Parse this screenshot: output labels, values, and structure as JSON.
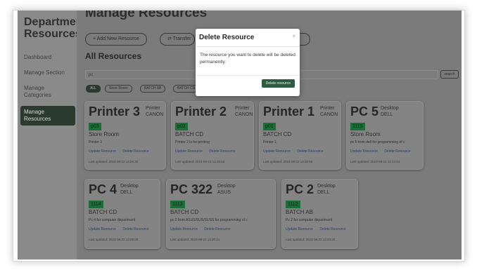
{
  "sidebar": {
    "brand_line1": "Department",
    "brand_line2": "Resources",
    "items": [
      {
        "label": "Dashboard"
      },
      {
        "label": "Manage Section"
      },
      {
        "label": "Manage Categories"
      },
      {
        "label": "Manage Resources"
      }
    ]
  },
  "header": {
    "title": "Manage Resources",
    "add_button": "+  Add New Resource",
    "transfer_button": "⇄  Transfer"
  },
  "list": {
    "title": "All Resources",
    "search_value": "pc",
    "search_button": "search",
    "filters": [
      "ALL",
      "Store Room",
      "BATCH AB",
      "BATCH CD"
    ]
  },
  "cards": [
    {
      "name": "Printer 3",
      "category": "Printer",
      "brand": "CANON",
      "code": "p03",
      "location": "Store Room",
      "description": "Printer 3",
      "update_label": "Update Resource",
      "delete_label": "Delete Resource",
      "updated": "Last updated: 2023-08-23 13:26:30"
    },
    {
      "name": "Printer 2",
      "category": "Printer",
      "brand": "CANON",
      "code": "p02",
      "location": "BATCH CD",
      "description": "Printer 2 is for printing",
      "update_label": "Update Resource",
      "delete_label": "Delete Resource",
      "updated": "Last updated: 2023-08-23 13:26:53"
    },
    {
      "name": "Printer 1",
      "category": "Printer",
      "brand": "CANON",
      "code": "p01",
      "location": "BATCH CD",
      "description": "Printer 1",
      "update_label": "Update Resource",
      "delete_label": "Delete Resource",
      "updated": "Last updated: 2023-08-23 13:26:58"
    },
    {
      "name": "PC 5",
      "category": "Desktop",
      "brand": "DELL",
      "code": "1115",
      "location": "Store Room",
      "description": "pc 5 from dell for programming of c",
      "update_label": "Update Resource",
      "delete_label": "Delete Resource",
      "updated": "Last updated: 2023-08-23 13:43:53"
    },
    {
      "name": "PC 4",
      "category": "Desktop",
      "brand": "DELL",
      "code": "1114",
      "location": "BATCH CD",
      "description": "Pc 4 for computer department",
      "update_label": "Update Resource",
      "delete_label": "Delete Resource",
      "updated": "Last updated: 2023-08-23 13:09:08"
    },
    {
      "name": "PC 322",
      "category": "Desktop",
      "brand": "ASUS",
      "code": "1113",
      "location": "BATCH CD",
      "description": "pc 2 from ASUS/SUS/SUSS for programming of c",
      "update_label": "Update Resource",
      "delete_label": "Delete Resource",
      "updated": "Last updated: 2023-08-23 13:20:21"
    },
    {
      "name": "PC 2",
      "category": "Desktop",
      "brand": "DELL",
      "code": "1112",
      "location": "BATCH AB",
      "description": "Pc 2 for computer department",
      "update_label": "Update Resource",
      "delete_label": "Delete Resource",
      "updated": "Last updated: 2023-08-23 13:43:20"
    }
  ],
  "modal": {
    "title": "Delete Resource",
    "close": "×",
    "body": "The resource you want to delete will be deleted permanently.",
    "confirm_button": "Delete resource"
  },
  "colors": {
    "accent": "#2e5a41",
    "code_badge": "#1b6e38",
    "overlay_dim": "#7b7b7b"
  }
}
